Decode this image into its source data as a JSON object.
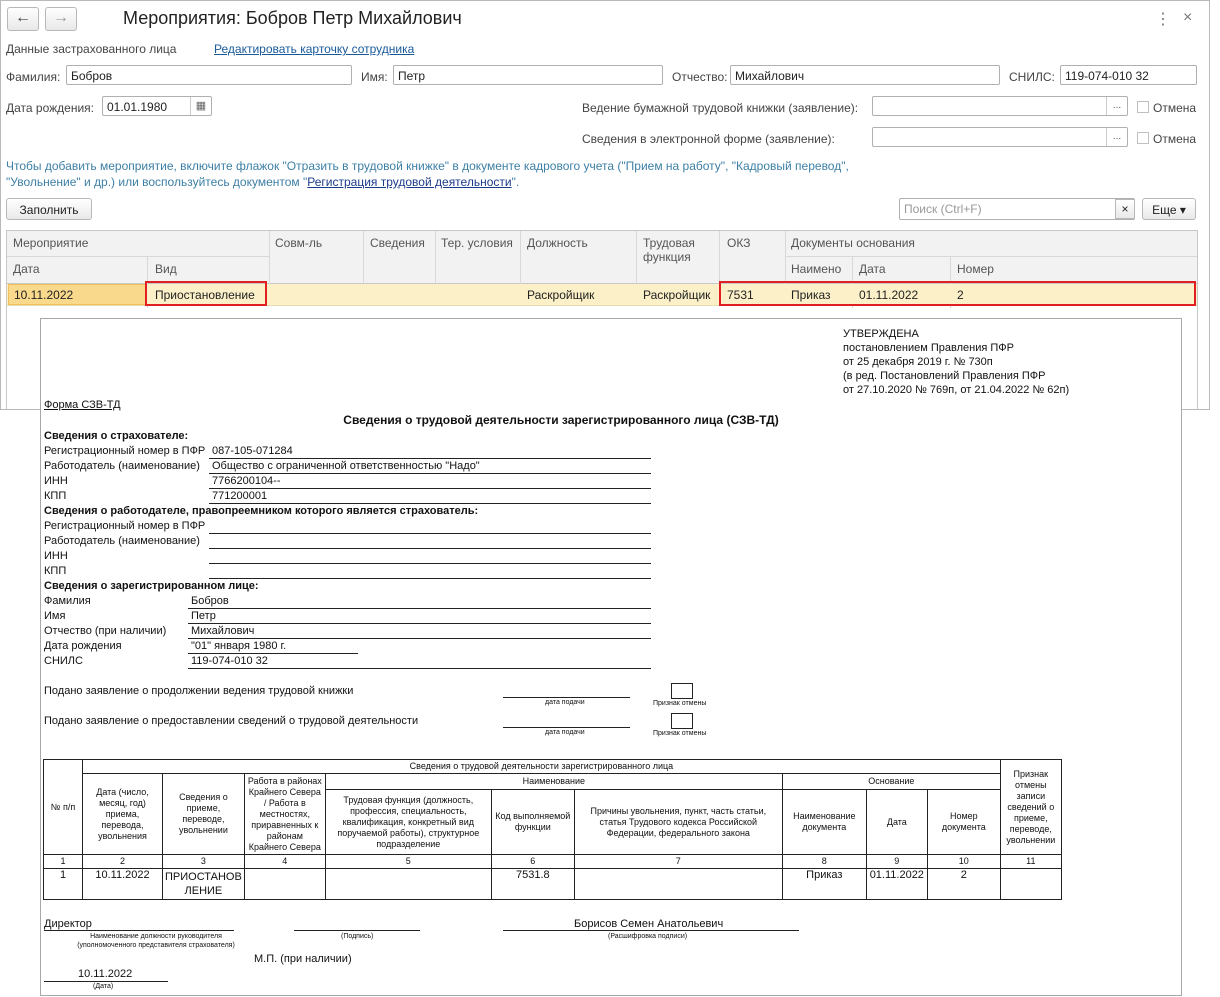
{
  "window": {
    "title": "Мероприятия: Бобров Петр Михайлович",
    "back_icon": "←",
    "forward_icon": "→",
    "more_icon": "⋮",
    "close_icon": "×"
  },
  "insured": {
    "section_label": "Данные застрахованного лица",
    "edit_link": "Редактировать карточку сотрудника",
    "surname_label": "Фамилия:",
    "surname_value": "Бобров",
    "name_label": "Имя:",
    "name_value": "Петр",
    "patronymic_label": "Отчество:",
    "patronymic_value": "Михайлович",
    "snils_label": "СНИЛС:",
    "snils_value": "119-074-010 32",
    "birth_label": "Дата рождения:",
    "birth_value": "01.01.1980",
    "paper_book_label": "Ведение бумажной трудовой книжки (заявление):",
    "electronic_label": "Сведения в электронной форме (заявление):",
    "cancel_label": "Отмена",
    "dots": "..."
  },
  "hint": {
    "text_before": "Чтобы добавить мероприятие, включите флажок \"Отразить в трудовой книжке\" в документе кадрового учета (\"Прием на работу\", \"Кадровый перевод\", \"Увольнение\" и др.) или воспользуйтесь документом \"",
    "link": "Регистрация трудовой деятельности",
    "text_after": "\"."
  },
  "toolbar": {
    "fill_button": "Заполнить",
    "search_placeholder": "Поиск (Ctrl+F)",
    "clear_icon": "×",
    "more_button": "Еще ▾"
  },
  "grid": {
    "headers": {
      "event": "Мероприятие",
      "date": "Дата",
      "kind": "Вид",
      "combo": "Совм-ль",
      "info": "Сведения",
      "terr": "Тер. условия",
      "position": "Должность",
      "function": "Трудовая функция",
      "okz": "ОКЗ",
      "docs": "Документы основания",
      "doc_name": "Наимено",
      "doc_date": "Дата",
      "doc_number": "Номер"
    },
    "row": {
      "date": "10.11.2022",
      "kind": "Приостановление",
      "position": "Раскройщик",
      "function": "Раскройщик",
      "okz": "7531",
      "doc_name": "Приказ",
      "doc_date": "01.11.2022",
      "doc_number": "2"
    }
  },
  "form": {
    "approved": [
      "УТВЕРЖДЕНА",
      "постановлением Правления ПФР",
      "от 25 декабря 2019 г. № 730п",
      "(в ред. Постановлений Правления ПФР",
      "от 27.10.2020 № 769п, от 21.04.2022 № 62п)"
    ],
    "form_name": "Форма СЗВ-ТД",
    "title": "Сведения о трудовой деятельности зарегистрированного лица (СЗВ-ТД)",
    "insurer_header": "Сведения о страхователе:",
    "reg_label": "Регистрационный номер в ПФР",
    "reg_value": "087-105-071284",
    "employer_label": "Работодатель (наименование)",
    "employer_value": "Общество с ограниченной ответственностью \"Надо\"",
    "inn_label": "ИНН",
    "inn_value": "7766200104--",
    "kpp_label": "КПП",
    "kpp_value": "771200001",
    "successor_header": "Сведения о работодателе, правопреемником которого является страхователь:",
    "person_header": "Сведения о зарегистрированном лице:",
    "surname_label": "Фамилия",
    "surname_value": "Бобров",
    "name_label": "Имя",
    "name_value": "Петр",
    "patronymic_label": "Отчество (при наличии)",
    "patronymic_value": "Михайлович",
    "birth_label": "Дата рождения",
    "birth_value": "\"01\" января 1980 г.",
    "snils_label": "СНИЛС",
    "snils_value": "119-074-010 32",
    "statement1": "Подано заявление о продолжении ведения трудовой книжки",
    "statement2": "Подано заявление о предоставлении сведений о трудовой деятельности",
    "date_submit": "дата подачи",
    "cancel_sign": "Признак отмены",
    "table": {
      "top_header": "Сведения о трудовой деятельности зарегистрированного лица",
      "col_num": "№ п/п",
      "col_date": "Дата (число, месяц, год) приема, перевода, увольнения",
      "col_info": "Сведения о приеме, переводе, увольнении",
      "col_north": "Работа в районах Крайнего Севера / Работа в местностях, приравненных к районам Крайнего Севера",
      "name_group": "Наименование",
      "col_function": "Трудовая функция (должность, профессия, специальность, квалификация, конкретный вид поручаемой работы), структурное подразделение",
      "col_code": "Код выполняемой функции",
      "col_reasons": "Причины увольнения, пункт, часть статьи, статья Трудового кодекса Российской Федерации, федерального закона",
      "basis_group": "Основание",
      "col_docname": "Наименование документа",
      "col_docdate": "Дата",
      "col_docnum": "Номер документа",
      "col_cancel": "Признак отмены записи сведений о приеме, переводе, увольнении",
      "numbers": [
        "1",
        "2",
        "3",
        "4",
        "5",
        "6",
        "7",
        "8",
        "9",
        "10",
        "11"
      ],
      "row": [
        "1",
        "10.11.2022",
        "ПРИОСТАНОВ ЛЕНИЕ",
        "",
        "",
        "7531.8",
        "",
        "Приказ",
        "01.11.2022",
        "2",
        ""
      ]
    },
    "director": "Директор",
    "director_caption": "Наименование должности руководителя (уполномоченного представителя страхователя)",
    "signature_caption": "(Подпись)",
    "signer_name": "Борисов Семен Анатольевич",
    "signer_caption": "(Расшифровка подписи)",
    "stamp": "М.П. (при наличии)",
    "sign_date": "10.11.2022",
    "date_caption": "(Дата)"
  }
}
